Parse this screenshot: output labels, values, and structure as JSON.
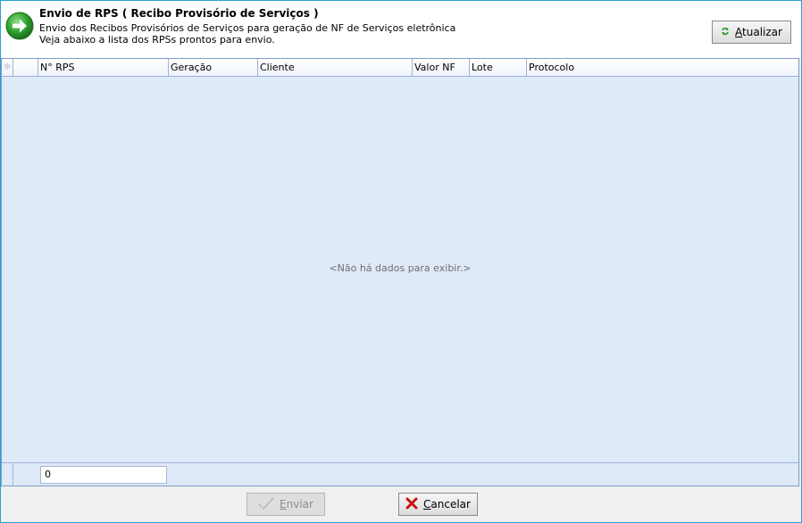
{
  "header": {
    "title": "Envio de RPS ( Recibo Provisório de Serviços )",
    "line1": "Envio dos Recibos Provisórios de Serviços para geração de NF de Serviços eletrônica",
    "line2": "Veja abaixo a lista dos RPSs prontos para envio.",
    "icon": "green-arrow-right-icon"
  },
  "toolbar": {
    "refresh_label": "Atualizar",
    "refresh_icon": "refresh-icon"
  },
  "grid": {
    "indicator_glyph": "✻",
    "columns": [
      "N° RPS",
      "Geração",
      "Cliente",
      "Valor NF",
      "Lote",
      "Protocolo"
    ],
    "empty_message": "<Não há dados para exibir.>",
    "footer_value": "0"
  },
  "actions": {
    "send_label": "Enviar",
    "cancel_label": "Cancelar"
  },
  "colors": {
    "accent": "#2ea0d6",
    "grid_background": "#dfeaf8",
    "arrow_green": "#2ca02c",
    "cancel_red": "#cc1111"
  }
}
